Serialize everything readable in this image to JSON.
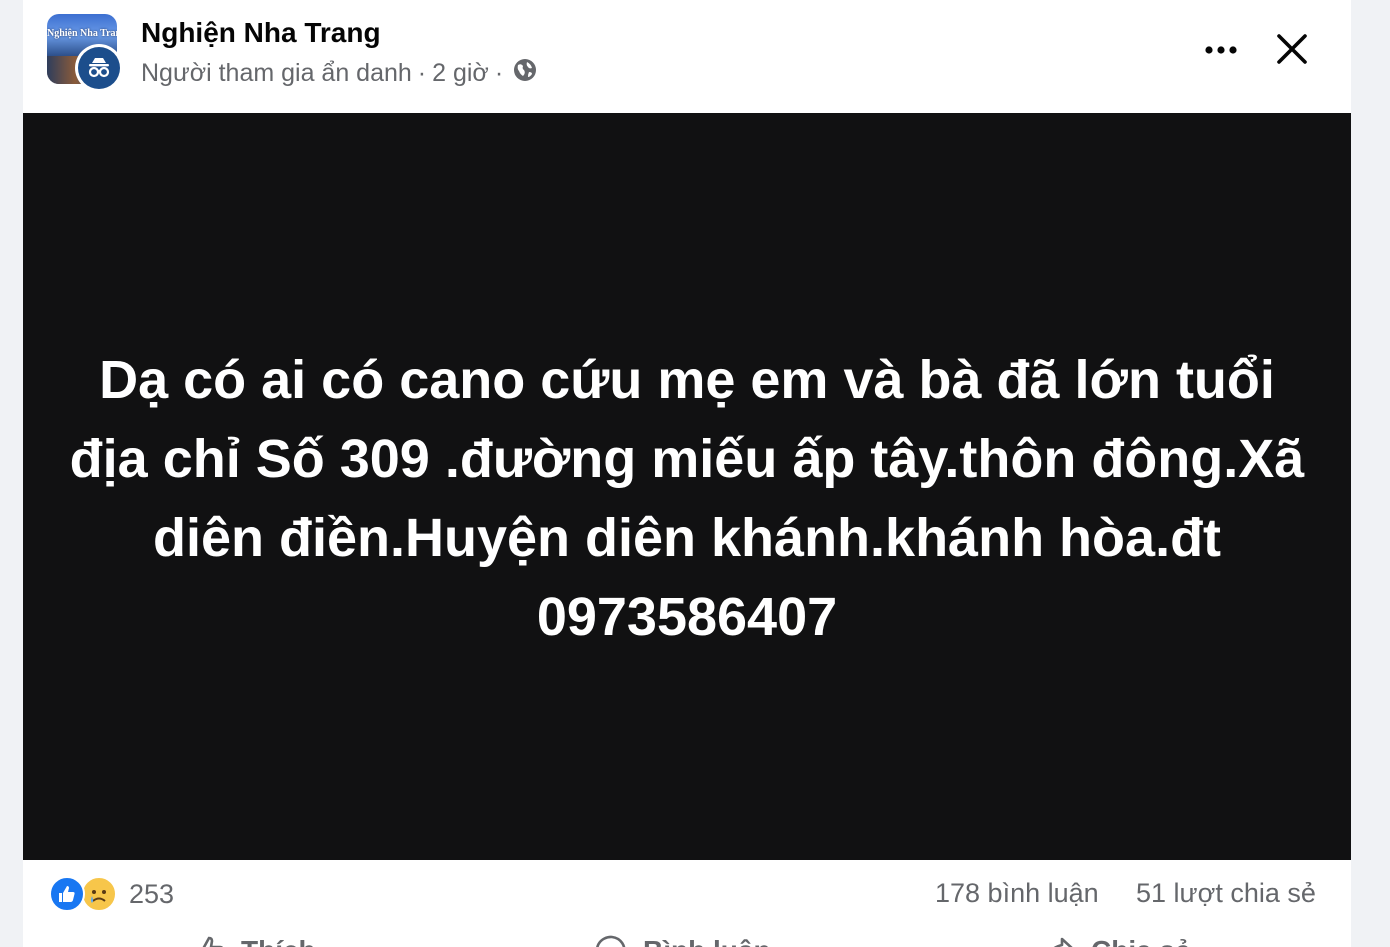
{
  "post": {
    "page_name": "Nghiện Nha Trang",
    "author_label": "Người tham gia ẩn danh",
    "separator": "·",
    "time_ago": "2 giờ",
    "avatar_text": "Nghiện Nha Trang",
    "audience_icon": "globe-icon",
    "more_icon": "more-options-icon",
    "close_icon": "close-icon",
    "body_text": "Dạ có ai có cano cứu mẹ em và bà đã lớn tuổi địa chỉ Số 309 .đường miếu ấp tây.thôn đông.Xã diên điền.Huyện diên khánh.khánh hòa.đt 0973586407"
  },
  "stats": {
    "reaction_icons": [
      "like-icon",
      "sad-icon"
    ],
    "reaction_count": "253",
    "comment_count": "178 bình luận",
    "share_count": "51 lượt chia sẻ"
  },
  "actions": {
    "like_label": "Thích",
    "comment_label": "Bình luận",
    "share_label": "Chia sẻ"
  },
  "colors": {
    "background": "#f0f2f5",
    "card": "#ffffff",
    "post_background": "#111112",
    "post_text": "#ffffff",
    "secondary_text": "#65676b",
    "like_blue": "#1877f2",
    "sad_yellow": "#f7c64a"
  }
}
